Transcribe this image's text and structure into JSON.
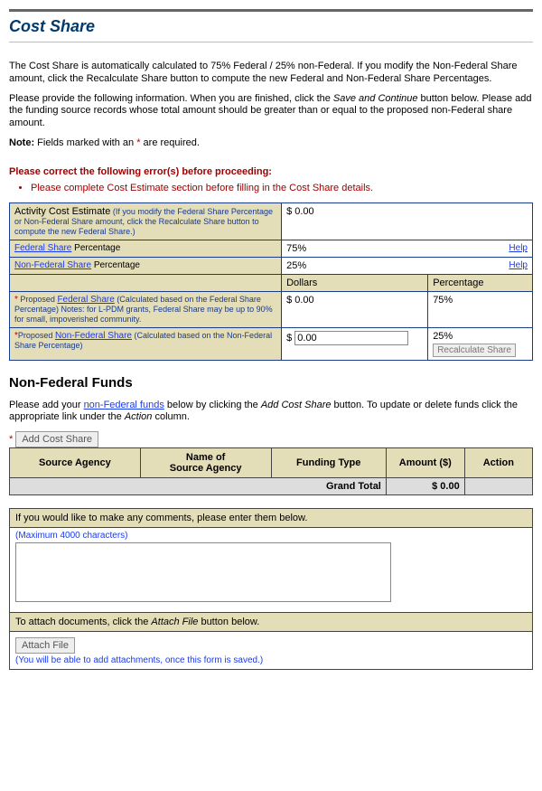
{
  "page": {
    "title": "Cost Share",
    "intro1": "The Cost Share is automatically calculated to 75% Federal / 25% non-Federal. If you modify the Non-Federal Share amount, click the Recalculate Share button to compute the new Federal and Non-Federal Share Percentages.",
    "intro2a": "Please provide the following information. When you are finished, click the ",
    "intro2_em": "Save and Continue",
    "intro2b": " button below. Please add the funding source records whose total amount should be greater than or equal to the proposed non-Federal share amount.",
    "note_prefix": "Note:",
    "note_text": " Fields marked with an ",
    "note_suffix": " are required.",
    "asterisk": "*"
  },
  "errors": {
    "heading": "Please correct the following error(s) before proceeding:",
    "items": [
      "Please complete Cost Estimate section before filling in the Cost Share details."
    ]
  },
  "cost": {
    "row_ace_label": "Activity Cost Estimate",
    "row_ace_note": " (If you modify the Federal Share Percentage or Non-Federal Share amount, click the Recalculate Share button to compute the new Federal Share.)",
    "ace_value": "$ 0.00",
    "fed_link": "Federal Share",
    "fed_suffix": " Percentage",
    "fed_value": "75%",
    "nonfed_link": "Non-Federal Share",
    "nonfed_suffix": " Percentage",
    "nonfed_value": "25%",
    "help_label": "Help",
    "dollars_header": "Dollars",
    "percent_header": "Percentage",
    "pfs_prefix": " Proposed ",
    "pfs_link": "Federal Share",
    "pfs_note": " (Calculated based on the Federal Share Percentage) Notes: for L-PDM grants, Federal Share may be up to 90% for small, impoverished community.",
    "pfs_dollar": "$ 0.00",
    "pfs_percent": "75%",
    "pnfs_prefix": "Proposed ",
    "pnfs_link": "Non-Federal Share",
    "pnfs_note": " (Calculated based on the Non-Federal Share Percentage)",
    "pnfs_dollar_prefix": "$ ",
    "pnfs_dollar_value": "0.00",
    "pnfs_percent": "25%",
    "recalc_label": "Recalculate Share"
  },
  "funds": {
    "section_title": "Non-Federal Funds",
    "intro_a": "Please add your ",
    "intro_link": "non-Federal funds",
    "intro_b": " below by clicking the ",
    "intro_em": "Add Cost Share",
    "intro_c": " button. To update or delete funds click the appropriate link under the ",
    "intro_em2": "Action",
    "intro_d": " column.",
    "add_label": "Add Cost Share",
    "col_source": "Source Agency",
    "col_name": "Name of\nSource Agency",
    "col_type": "Funding Type",
    "col_amount": "Amount ($)",
    "col_action": "Action",
    "grand_total_label": "Grand Total",
    "grand_total_value": "$ 0.00"
  },
  "comments": {
    "heading": "If you would like to make any comments, please enter them below.",
    "max": "(Maximum 4000 characters)"
  },
  "attach": {
    "heading_a": "To attach documents, click the ",
    "heading_em": "Attach File",
    "heading_b": " button below.",
    "button": "Attach File",
    "note": "(You will be able to add attachments, once this form is saved.)"
  }
}
